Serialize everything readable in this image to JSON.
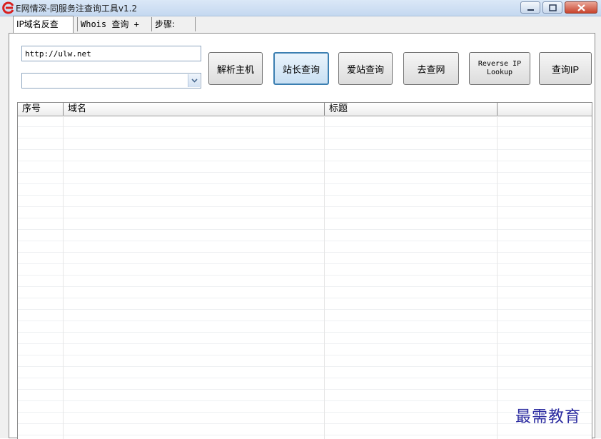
{
  "window": {
    "title": "E网情深-同服务注查询工具v1.2",
    "accent_color": "#d82020"
  },
  "tabs": [
    {
      "label": "IP域名反查",
      "active": true
    },
    {
      "label": "Whois 查询 +",
      "active": false
    },
    {
      "label": "步骤:",
      "active": false
    }
  ],
  "query": {
    "url_value": "http://ulw.net",
    "combo_value": ""
  },
  "buttons": {
    "resolve_host": "解析主机",
    "chinaz_query": "站长查询",
    "aizhan_query": "爱站查询",
    "go_query": "去查网",
    "reverse_ip_line1": "Reverse IP",
    "reverse_ip_line2": "Lookup",
    "query_ip": "查询IP"
  },
  "table": {
    "columns": [
      "序号",
      "域名",
      "标题",
      ""
    ],
    "rows": []
  },
  "watermark": "最需教育"
}
